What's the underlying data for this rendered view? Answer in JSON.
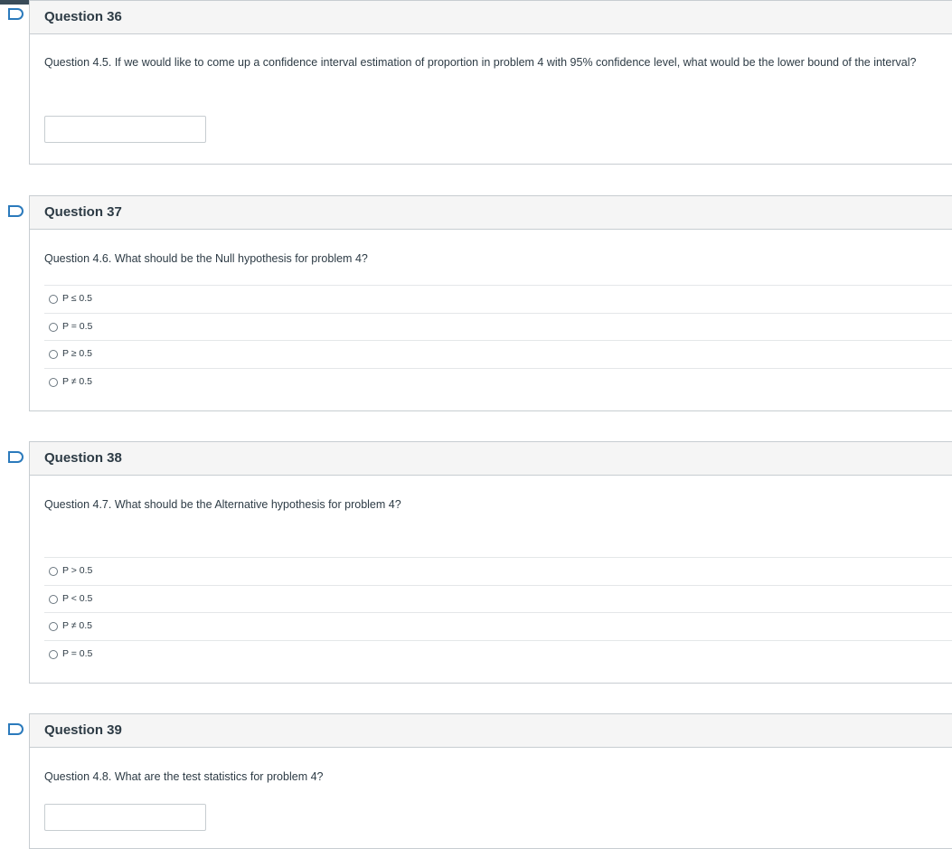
{
  "questions": [
    {
      "title": "Question 36",
      "text": "Question 4.5. If we would like to come up a confidence interval estimation of proportion in problem 4 with 95% confidence level, what would be the lower bound of the interval?",
      "type": "input",
      "value": ""
    },
    {
      "title": "Question 37",
      "text": "Question 4.6. What should be the Null hypothesis for problem 4?",
      "type": "radio",
      "options": [
        "P ≤ 0.5",
        "P = 0.5",
        "P ≥ 0.5",
        "P ≠ 0.5"
      ]
    },
    {
      "title": "Question 38",
      "text": "Question 4.7. What should be the Alternative hypothesis for problem 4?",
      "type": "radio",
      "options": [
        "P > 0.5",
        "P < 0.5",
        "P ≠ 0.5",
        "P = 0.5"
      ]
    },
    {
      "title": "Question 39",
      "text": "Question 4.8. What are the test statistics for problem 4?",
      "type": "input",
      "value": ""
    }
  ],
  "icons": {
    "flag": "flag-bookmark-icon"
  },
  "colors": {
    "flag": "#2b7abc",
    "header_bg": "#f5f5f5",
    "border": "#c7cdd1",
    "topbar": "#394b58"
  }
}
